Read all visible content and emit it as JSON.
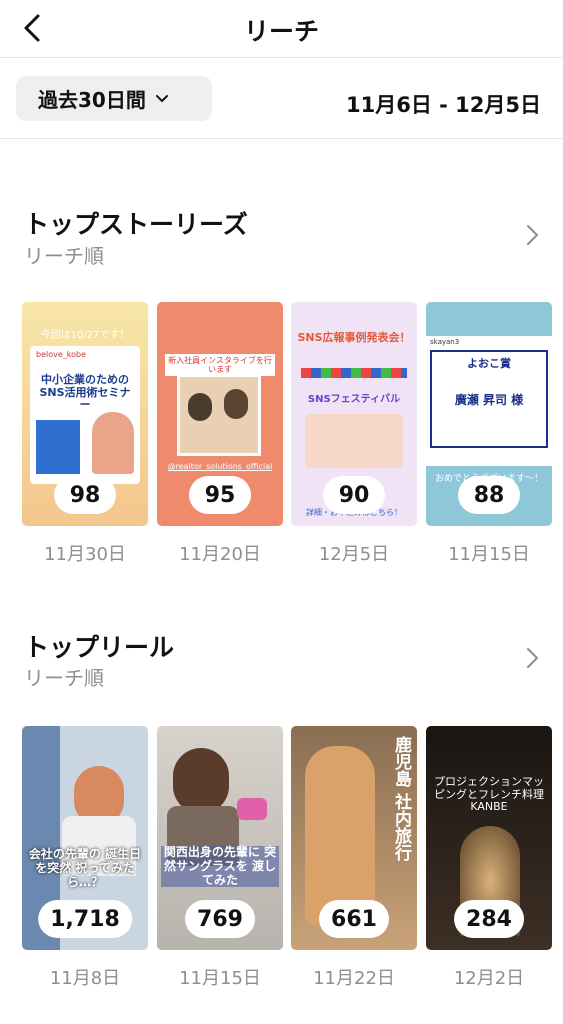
{
  "header": {
    "title": "リーチ"
  },
  "filter": {
    "range_label": "過去30日間",
    "date_range": "11月6日 - 12月5日"
  },
  "top_stories": {
    "title": "トップストーリーズ",
    "subtitle": "リーチ順",
    "items": [
      {
        "value": "98",
        "date": "11月30日",
        "caption_top": "今回は10/27です！",
        "caption_main": "中小企業のための SNS活用術セミナー",
        "account": "belove_kobe"
      },
      {
        "value": "95",
        "date": "11月20日",
        "caption_top": "新入社員インスタライブを行います",
        "caption_main": "@realtor_solutions_official"
      },
      {
        "value": "90",
        "date": "12月5日",
        "caption_top": "SNS広報事例発表会！",
        "caption_main": "SNSフェスティバル",
        "caption_bottom": "詳細・お申込みはこちら！"
      },
      {
        "value": "88",
        "date": "11月15日",
        "caption_top": "よおこ賞",
        "caption_main": "廣瀬 昇司 様",
        "caption_bottom": "おめでとうございます〜！",
        "account": "skayan3"
      }
    ]
  },
  "top_reels": {
    "title": "トップリール",
    "subtitle": "リーチ順",
    "items": [
      {
        "value": "1,718",
        "date": "11月8日",
        "caption": "会社の先輩の 誕生日を突然 祝ってみたら…？"
      },
      {
        "value": "769",
        "date": "11月15日",
        "caption": "関西出身の先輩に 突然サングラスを 渡してみた"
      },
      {
        "value": "661",
        "date": "11月22日",
        "caption": "鹿児島 社内旅行"
      },
      {
        "value": "284",
        "date": "12月2日",
        "caption": "プロジェクションマッピングとフレンチ料理 KANBE"
      }
    ]
  },
  "colors": {
    "badge_bg": "#ffffff",
    "muted_text": "#8e8e8e",
    "divider": "#e6e6e6"
  }
}
